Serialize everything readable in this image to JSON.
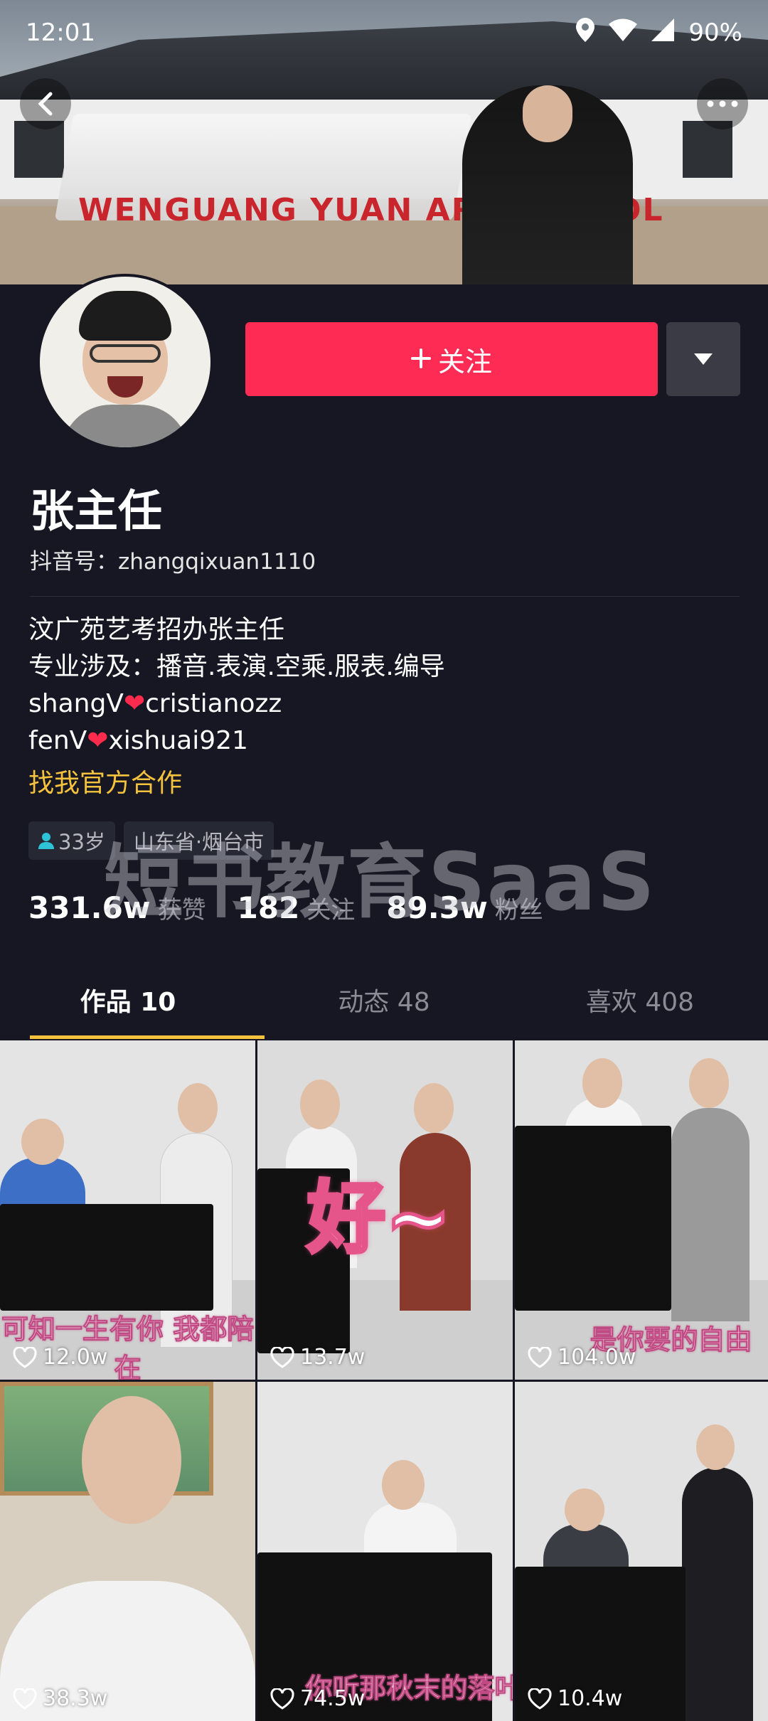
{
  "status_bar": {
    "time": "12:01",
    "battery": "90%"
  },
  "profile": {
    "name": "张主任",
    "douyin_id": "抖音号：zhangqixuan1110",
    "follow_label": "关注",
    "bio_lines": [
      "汶广苑艺考招办张主任",
      "专业涉及：播音.表演.空乘.服表.编导"
    ],
    "bio_contact_1": {
      "prefix": "shangV",
      "suffix": "cristianozz"
    },
    "bio_contact_2": {
      "prefix": "fenV",
      "suffix": "xishuai921"
    },
    "collab_link": "找我官方合作",
    "tags": [
      "33岁",
      "山东省·烟台市"
    ],
    "banner_sign": "WENGUANG YUAN ART SCHOOL"
  },
  "watermark": "短书教育SaaS",
  "stats": [
    {
      "num": "331.6w",
      "label": "获赞"
    },
    {
      "num": "182",
      "label": "关注"
    },
    {
      "num": "89.3w",
      "label": "粉丝"
    }
  ],
  "tabs": [
    {
      "label": "作品 10"
    },
    {
      "label": "动态 48"
    },
    {
      "label": "喜欢 408"
    }
  ],
  "videos": [
    {
      "likes": "12.0w",
      "caption": "可知一生有你 我都陪在"
    },
    {
      "likes": "13.7w",
      "caption": "好~"
    },
    {
      "likes": "104.0w",
      "caption": "是你要的自由"
    },
    {
      "likes": "38.3w",
      "caption": ""
    },
    {
      "likes": "74.5w",
      "caption": "你听那秋末的落叶"
    },
    {
      "likes": "10.4w",
      "caption": ""
    }
  ],
  "colors": {
    "accent": "#fe2c55",
    "highlight": "#f4c23c",
    "background": "#161722"
  }
}
